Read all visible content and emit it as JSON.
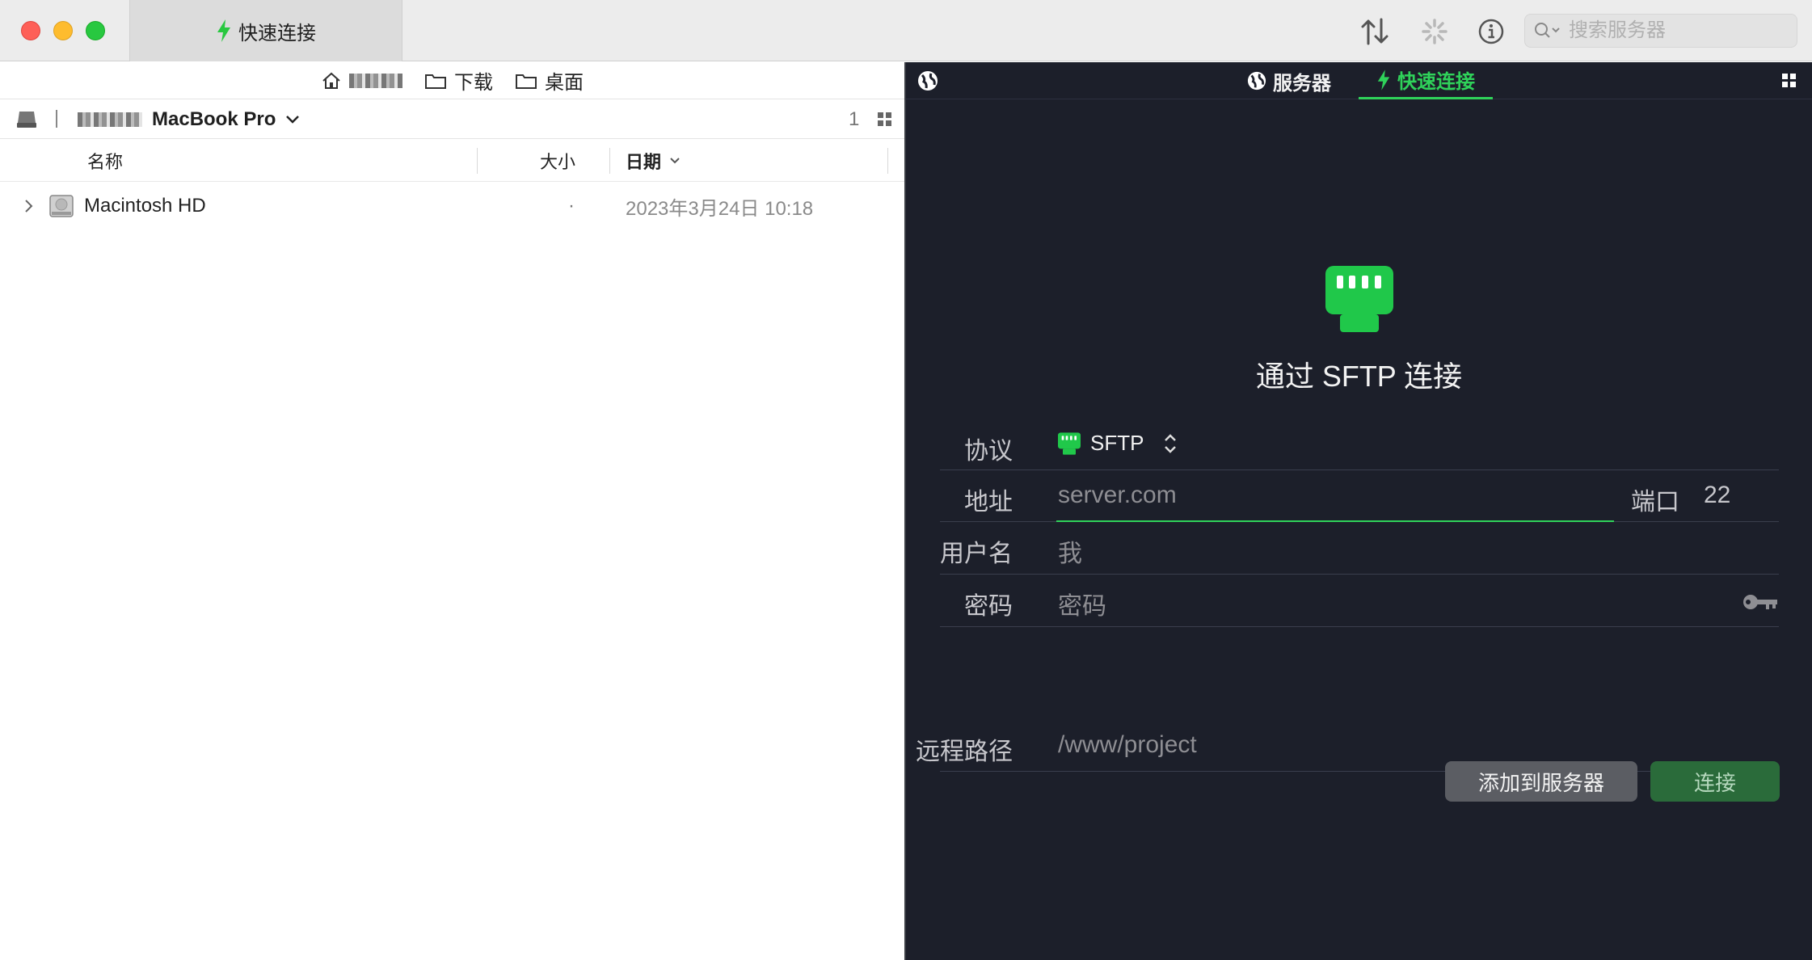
{
  "titlebar": {
    "tab_title": "快速连接",
    "search_placeholder": "搜索服务器"
  },
  "left": {
    "bookmarks": [
      "下载",
      "桌面"
    ],
    "path_device": "MacBook Pro",
    "item_count": "1",
    "columns": {
      "name": "名称",
      "size": "大小",
      "date": "日期"
    },
    "files": [
      {
        "name": "Macintosh HD",
        "size": "·",
        "date": "2023年3月24日 10:18"
      }
    ]
  },
  "right": {
    "tabs": {
      "servers": "服务器",
      "quick": "快速连接"
    },
    "hero_title": "通过 SFTP 连接",
    "form": {
      "protocol_label": "协议",
      "protocol_value": "SFTP",
      "address_label": "地址",
      "address_placeholder": "server.com",
      "port_label": "端口",
      "port_value": "22",
      "username_label": "用户名",
      "username_value": "我",
      "password_label": "密码",
      "password_placeholder": "密码",
      "remote_path_label": "远程路径",
      "remote_path_placeholder": "/www/project"
    },
    "buttons": {
      "add": "添加到服务器",
      "connect": "连接"
    }
  },
  "colors": {
    "accent_green": "#2fd25a",
    "dark_bg": "#1c1f2a"
  }
}
